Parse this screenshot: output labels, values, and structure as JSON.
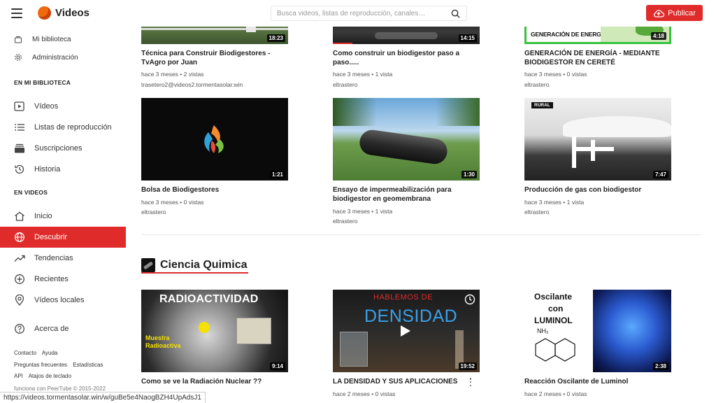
{
  "header": {
    "brand": "Videos",
    "search_placeholder": "Busca videos, listas de reproducción, canales…",
    "publish_label": "Publicar"
  },
  "sidebar": {
    "top_items": [
      {
        "label": "Mi biblioteca",
        "icon": "library-icon"
      },
      {
        "label": "Administración",
        "icon": "gear-icon"
      }
    ],
    "library_heading": "EN MI BIBLIOTECA",
    "library_items": [
      {
        "label": "Vídeos",
        "icon": "video-play-icon"
      },
      {
        "label": "Listas de reproducción",
        "icon": "playlist-icon"
      },
      {
        "label": "Suscripciones",
        "icon": "subscriptions-icon"
      },
      {
        "label": "Historia",
        "icon": "history-icon"
      }
    ],
    "videos_heading": "EN VIDEOS",
    "video_items": [
      {
        "label": "Inicio",
        "icon": "home-icon"
      },
      {
        "label": "Descubrir",
        "icon": "globe-icon",
        "active": true
      },
      {
        "label": "Tendencias",
        "icon": "trending-icon"
      },
      {
        "label": "Recientes",
        "icon": "plus-circle-icon"
      },
      {
        "label": "Vídeos locales",
        "icon": "location-icon"
      }
    ],
    "about": {
      "label": "Acerca de",
      "icon": "help-icon"
    },
    "footer_links_row1": [
      "Contacto",
      "Ayuda"
    ],
    "footer_links_row2": [
      "Preguntas frecuentes",
      "Estadísticas"
    ],
    "footer_links_row3": [
      "API",
      "Atajos de teclado"
    ],
    "powered_by": "funciona con PeerTube © 2015-2022"
  },
  "videos_row1": [
    {
      "title": "Técnica para Construir Biodigestores - TvAgro por Juan",
      "meta": "hace 3 meses • 2 vistas",
      "channel": "trasetero2@videos2.tormentasolar.win",
      "duration": "18:23"
    },
    {
      "title": "Como construir un biodigestor paso a paso.....",
      "meta": "hace 3 meses • 1 vista",
      "channel": "eltrastero",
      "duration": "14:15"
    },
    {
      "title": "GENERACIÓN DE ENERGÍA - MEDIANTE BIODIGESTOR EN CERETÉ",
      "meta": "hace 3 meses • 0 vistas",
      "channel": "eltrastero",
      "duration": "4:18",
      "thumb_text": "GENERACIÓN DE ENERGÍA"
    }
  ],
  "videos_row2": [
    {
      "title": "Bolsa de Biodigestores",
      "meta": "hace 3 meses • 0 vistas",
      "channel": "eltrastero",
      "duration": "1:21"
    },
    {
      "title": "Ensayo de impermeabilización para biodigestor en geomembrana",
      "meta": "hace 3 meses • 1 vista",
      "channel": "eltrastero",
      "duration": "1:30"
    },
    {
      "title": "Producción de gas con biodigestor",
      "meta": "hace 3 meses • 1 vista",
      "channel": "eltrastero",
      "duration": "7:47",
      "thumb_badge": "RURAL"
    }
  ],
  "category": {
    "title": "Ciencia Quimica"
  },
  "videos_row3": [
    {
      "title": "Como se ve la Radiación Nuclear ??",
      "duration": "9:14",
      "thumb_title": "RADIOACTIVIDAD",
      "thumb_label": "Muestra Radioactiva"
    },
    {
      "title": "LA DENSIDAD Y SUS APLICACIONES",
      "meta": "hace 2 meses • 0 vistas",
      "duration": "19:52",
      "thumb_line1": "HABLEMOS DE",
      "thumb_line2": "DENSIDAD"
    },
    {
      "title": "Reacción Oscilante de Luminol",
      "meta": "hace 2 meses • 0 vistas",
      "duration": "2:38",
      "thumb_line1": "Oscilante",
      "thumb_line2": "con",
      "thumb_line3": "LUMINOL",
      "thumb_chem": "NH₂"
    }
  ],
  "statusbar_url": "https://videos.tormentasolar.win/w/guBe5e4NaogBZH4UpAdsJ1"
}
